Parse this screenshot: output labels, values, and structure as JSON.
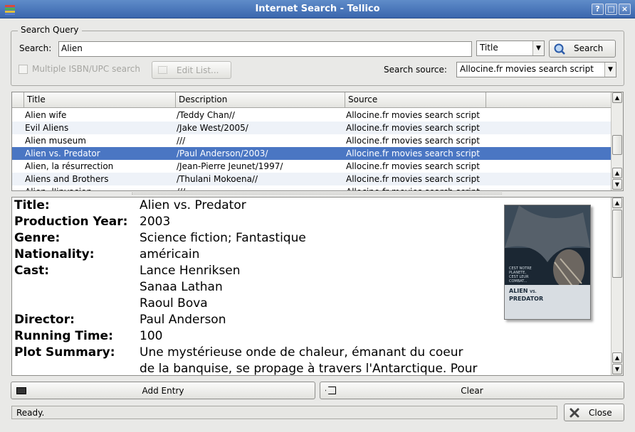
{
  "window": {
    "title": "Internet Search - Tellico",
    "help_btn": "?",
    "min_btn": "_",
    "max_btn": "□",
    "close_btn": "×"
  },
  "search_query": {
    "group_label": "Search Query",
    "search_label": "Search:",
    "search_value": "Alien",
    "field_selected": "Title",
    "search_button": "Search",
    "multiple_isbn_label": "Multiple ISBN/UPC search",
    "edit_list_button": "Edit List...",
    "source_label": "Search source:",
    "source_selected": "Allocine.fr movies search script"
  },
  "results": {
    "columns": [
      "Title",
      "Description",
      "Source"
    ],
    "rows": [
      {
        "title": "Alien wife",
        "description": "/Teddy Chan//",
        "source": "Allocine.fr movies search script"
      },
      {
        "title": "Evil Aliens",
        "description": "/Jake West/2005/",
        "source": "Allocine.fr movies search script"
      },
      {
        "title": "Alien museum",
        "description": "///",
        "source": "Allocine.fr movies search script"
      },
      {
        "title": "Alien vs. Predator",
        "description": "/Paul Anderson/2003/",
        "source": "Allocine.fr movies search script"
      },
      {
        "title": "Alien, la résurrection",
        "description": "/Jean-Pierre Jeunet/1997/",
        "source": "Allocine.fr movies search script"
      },
      {
        "title": "Aliens and Brothers",
        "description": "/Thulani Mokoena//",
        "source": "Allocine.fr movies search script"
      },
      {
        "title": "Alien, l'invasion",
        "description": "///",
        "source": "Allocine.fr movies search script"
      }
    ],
    "selected_index": 3
  },
  "detail": {
    "title_label": "Title:",
    "title_value": "Alien vs. Predator",
    "year_label": "Production Year:",
    "year_value": "2003",
    "genre_label": "Genre:",
    "genre_value": "Science fiction; Fantastique",
    "nationality_label": "Nationality:",
    "nationality_value": "américain",
    "cast_label": "Cast:",
    "cast": [
      "Lance Henriksen",
      "Sanaa Lathan",
      "Raoul Bova"
    ],
    "director_label": "Director:",
    "director_value": "Paul Anderson",
    "running_time_label": "Running Time:",
    "running_time_value": "100",
    "plot_label": "Plot Summary:",
    "plot_lines": [
      "Une mystérieuse onde de chaleur, émanant du coeur",
      "de la banquise, se propage à travers l'Antarctique. Pour"
    ],
    "poster_text": {
      "tagline_1": "CEST NOTRE",
      "tagline_2": "PLANETE,",
      "tagline_3": "CEST LEUR",
      "tagline_4": "COMBAT...",
      "title_line_1": "ALIEN",
      "title_vs": "VS.",
      "title_line_2": "PREDATOR"
    }
  },
  "actions": {
    "add_entry": "Add Entry",
    "clear": "Clear",
    "close": "Close"
  },
  "status": {
    "text": "Ready."
  }
}
